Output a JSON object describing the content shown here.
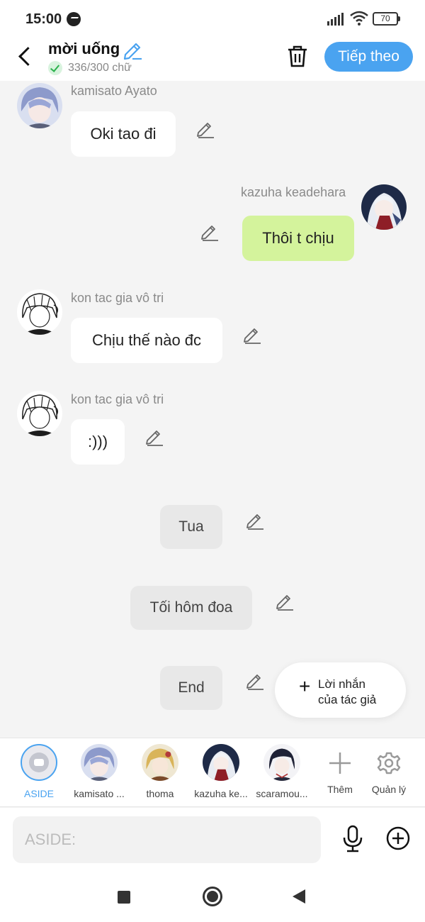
{
  "status_bar": {
    "time": "15:00",
    "battery": "70"
  },
  "header": {
    "title": "mời uống",
    "word_count": "336/300 chữ",
    "next_label": "Tiếp theo"
  },
  "messages": [
    {
      "sender": "kamisato Ayato",
      "text": "Oki tao đi"
    },
    {
      "sender": "kazuha keadehara",
      "text": "Thôi t chịu"
    },
    {
      "sender": "kon tac gia vô tri",
      "text": "Chịu thế nào đc"
    },
    {
      "sender": "kon tac gia vô tri",
      "text": ":)))"
    },
    {
      "text": "Tua"
    },
    {
      "text": "Tối hôm đoa"
    },
    {
      "text": "End"
    }
  ],
  "fab": {
    "line1": "Lời nhắn",
    "line2": "của tác giả"
  },
  "characters": [
    {
      "label": "ASIDE"
    },
    {
      "label": "kamisato ..."
    },
    {
      "label": "thoma"
    },
    {
      "label": "kazuha ke..."
    },
    {
      "label": "scaramou..."
    },
    {
      "label": "Thêm"
    },
    {
      "label": "Quản lý"
    }
  ],
  "input": {
    "placeholder": "ASIDE:"
  },
  "colors": {
    "accent": "#4aa3f0",
    "my_bubble": "#d4f39c",
    "background": "#f4f4f4"
  }
}
